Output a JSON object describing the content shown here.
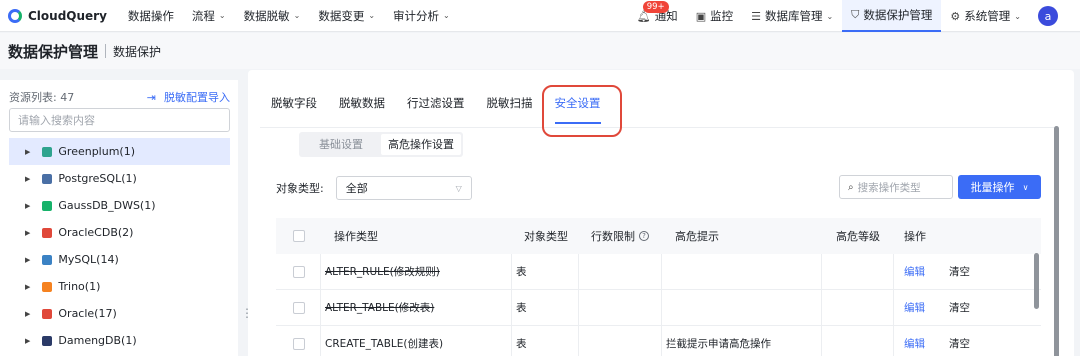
{
  "app": {
    "name": "CloudQuery"
  },
  "nav": {
    "items": [
      {
        "label": "数据操作",
        "dropdown": false
      },
      {
        "label": "流程",
        "dropdown": true
      },
      {
        "label": "数据脱敏",
        "dropdown": true
      },
      {
        "label": "数据变更",
        "dropdown": true
      },
      {
        "label": "审计分析",
        "dropdown": true
      }
    ],
    "notice": {
      "label": "通知",
      "badge": "99+"
    },
    "monitor": "监控",
    "db_manage": "数据库管理",
    "data_protect": "数据保护管理",
    "sys_manage": "系统管理",
    "avatar": "a"
  },
  "page": {
    "title": "数据保护管理",
    "crumb": "数据保护"
  },
  "left": {
    "count_label": "资源列表: 47",
    "import_label": "脱敏配置导入",
    "search_placeholder": "请输入搜索内容",
    "items": [
      {
        "label": "Greenplum(1)",
        "color": "#2ea38e",
        "active": true
      },
      {
        "label": "PostgreSQL(1)",
        "color": "#4a6fa5"
      },
      {
        "label": "GaussDB_DWS(1)",
        "color": "#17b26a"
      },
      {
        "label": "OracleCDB(2)",
        "color": "#e0483a"
      },
      {
        "label": "MySQL(14)",
        "color": "#3b82c4"
      },
      {
        "label": "Trino(1)",
        "color": "#f58220"
      },
      {
        "label": "Oracle(17)",
        "color": "#e0483a"
      },
      {
        "label": "DamengDB(1)",
        "color": "#2b3a67"
      }
    ]
  },
  "tabs": [
    "脱敏字段",
    "脱敏数据",
    "行过滤设置",
    "脱敏扫描",
    "安全设置"
  ],
  "active_tab": "安全设置",
  "segments": {
    "basic": "基础设置",
    "high_risk": "高危操作设置"
  },
  "filter": {
    "label": "对象类型:",
    "value": "全部",
    "search_placeholder": "搜索操作类型",
    "batch_label": "批量操作"
  },
  "table": {
    "headers": {
      "op_type": "操作类型",
      "obj_type": "对象类型",
      "row_limit": "行数限制",
      "risk_tip": "高危提示",
      "risk_level": "高危等级",
      "action": "操作"
    },
    "rows": [
      {
        "op": "ALTER_RULE(修改规则)",
        "obj": "表",
        "row_limit": "",
        "tip": "",
        "level": "",
        "edit": "编辑",
        "clear": "清空",
        "struck": true
      },
      {
        "op": "ALTER_TABLE(修改表)",
        "obj": "表",
        "row_limit": "",
        "tip": "",
        "level": "",
        "edit": "编辑",
        "clear": "清空",
        "struck": true
      },
      {
        "op": "CREATE_TABLE(创建表)",
        "obj": "表",
        "row_limit": "",
        "tip": "拦截提示申请高危操作",
        "level": "",
        "edit": "编辑",
        "clear": "清空",
        "struck": false
      }
    ]
  },
  "colors": {
    "accent": "#3b6cf6",
    "highlight": "#e0483a"
  }
}
